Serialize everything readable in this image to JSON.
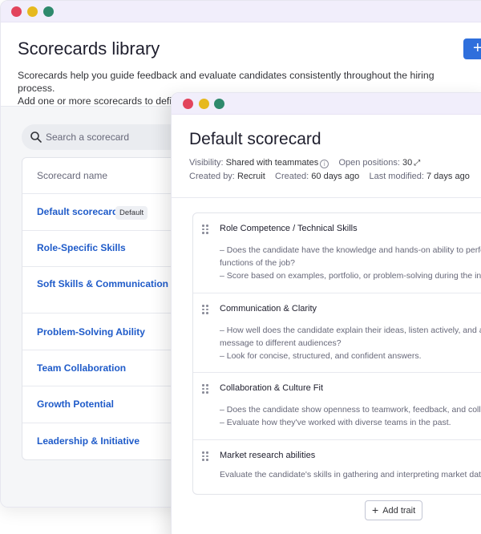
{
  "library": {
    "title": "Scorecards library",
    "description_line1": "Scorecards help you guide feedback and evaluate candidates consistently throughout the hiring process.",
    "description_line2": "Add one or more scorecards to define the skills and traits you want to evaluate in each interview. Learn more",
    "create_button_icon": "+",
    "search": {
      "placeholder": "Search a scorecard",
      "icon": "search-icon"
    },
    "column_header": "Scorecard name",
    "default_tag": "Default",
    "items": [
      {
        "label": "Default scorecard"
      },
      {
        "label": "Role-Specific Skills"
      },
      {
        "label": "Soft Skills & Communication"
      },
      {
        "label": "Problem-Solving Ability"
      },
      {
        "label": "Team Collaboration"
      },
      {
        "label": "Growth Potential"
      },
      {
        "label": "Leadership & Initiative"
      }
    ]
  },
  "scorecard": {
    "title": "Default scorecard",
    "visibility_label": "Visibility:",
    "visibility_value": "Shared with teammates",
    "open_positions_label": "Open positions:",
    "open_positions_value": "30",
    "created_by_label": "Created by:",
    "created_by_value": "Recruit",
    "created_label": "Created:",
    "created_value": "60 days ago",
    "modified_label": "Last modified:",
    "modified_value": "7 days ago",
    "traits": [
      {
        "name": "Role Competence / Technical Skills",
        "description": "– Does the candidate have the knowledge and hands-on ability to perform the core\nfunctions of the job?\n– Score based on examples, portfolio, or problem-solving during the interview."
      },
      {
        "name": "Communication & Clarity",
        "description": "– How well does the candidate explain their ideas, listen actively, and adapt their\nmessage to different audiences?\n– Look for concise, structured, and confident answers."
      },
      {
        "name": "Collaboration & Culture Fit",
        "description": "– Does the candidate show openness to teamwork, feedback, and collaboration?\n– Evaluate how they've worked with diverse teams in the past."
      },
      {
        "name": "Market research abilities",
        "description": "Evaluate the candidate's skills in gathering and interpreting market data."
      }
    ],
    "add_trait_label": "Add trait"
  },
  "colors": {
    "accent": "#2f6fdc",
    "link": "#1f5bc9",
    "titlebar": "#f1eefb"
  }
}
